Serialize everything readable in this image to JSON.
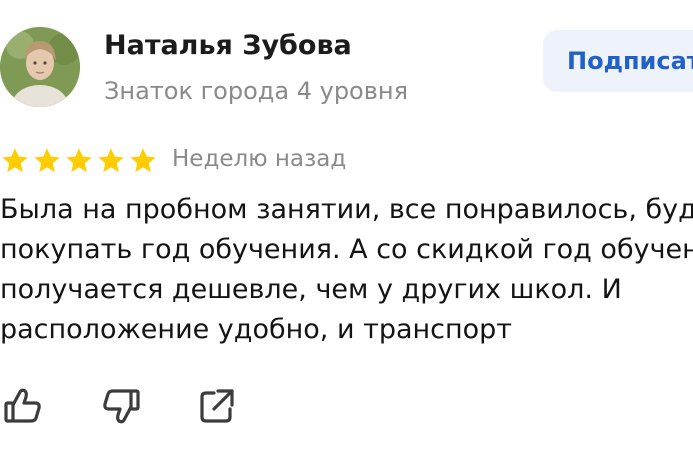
{
  "review": {
    "author_name": "Наталья Зубова",
    "author_level": "Знаток города 4 уровня",
    "subscribe_label": "Подписаться",
    "rating": 5,
    "rating_max": 5,
    "date": "Неделю назад",
    "text_lines": [
      "Была на пробном занятии, все понравилось, буду",
      "покупать год обучения. А со скидкой год обучения",
      "получается дешевле, чем у других школ. И",
      "расположение удобно, и транспорт"
    ]
  },
  "actions": [
    {
      "icon": "thumbs-up-icon"
    },
    {
      "icon": "thumbs-down-icon"
    },
    {
      "icon": "share-icon"
    }
  ],
  "colors": {
    "star": "#ffcc00",
    "accent": "#2260c9",
    "subscribe_bg": "#eef3fb",
    "muted_text": "#8a8a8a"
  }
}
